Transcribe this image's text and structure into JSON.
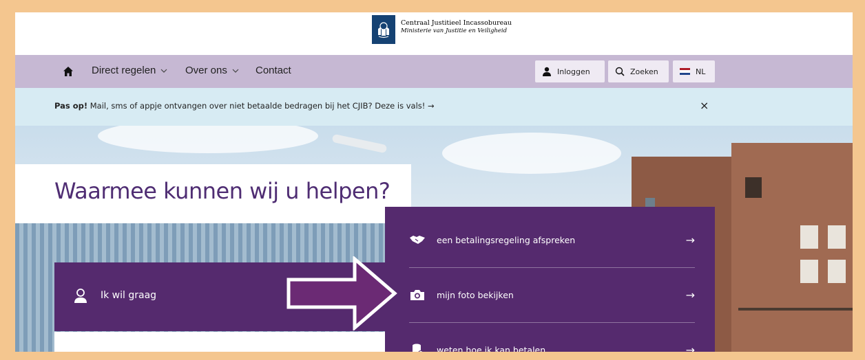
{
  "header": {
    "org_name": "Centraal Justitieel Incassobureau",
    "ministry": "Ministerie van Justitie en Veiligheid"
  },
  "nav": {
    "home_icon": "home-icon",
    "items": [
      {
        "label": "Direct regelen",
        "has_dropdown": true
      },
      {
        "label": "Over ons",
        "has_dropdown": true
      },
      {
        "label": "Contact",
        "has_dropdown": false
      }
    ],
    "login_label": "Inloggen",
    "search_label": "Zoeken",
    "language_label": "NL"
  },
  "alert": {
    "bold": "Pas op!",
    "text": " Mail, sms of appje ontvangen over niet betaalde bedragen bij het CJIB? Deze is vals! →",
    "close": "×"
  },
  "hero": {
    "title": "Waarmee kunnen wij u helpen?",
    "want_label": "Ik wil graag",
    "options": [
      {
        "label": "een betalingsregeling afspreken",
        "icon": "handshake-icon",
        "arrow": "→"
      },
      {
        "label": "mijn foto bekijken",
        "icon": "camera-icon",
        "arrow": "→"
      },
      {
        "label": "weten hoe ik kan betalen",
        "icon": "coins-icon",
        "arrow": "→"
      }
    ]
  },
  "colors": {
    "frame": "#f4c68f",
    "nav": "#c6b8d3",
    "alert": "#d7ebf3",
    "purple": "#552a6e",
    "title": "#4f2d73",
    "logo_blue": "#154273"
  }
}
